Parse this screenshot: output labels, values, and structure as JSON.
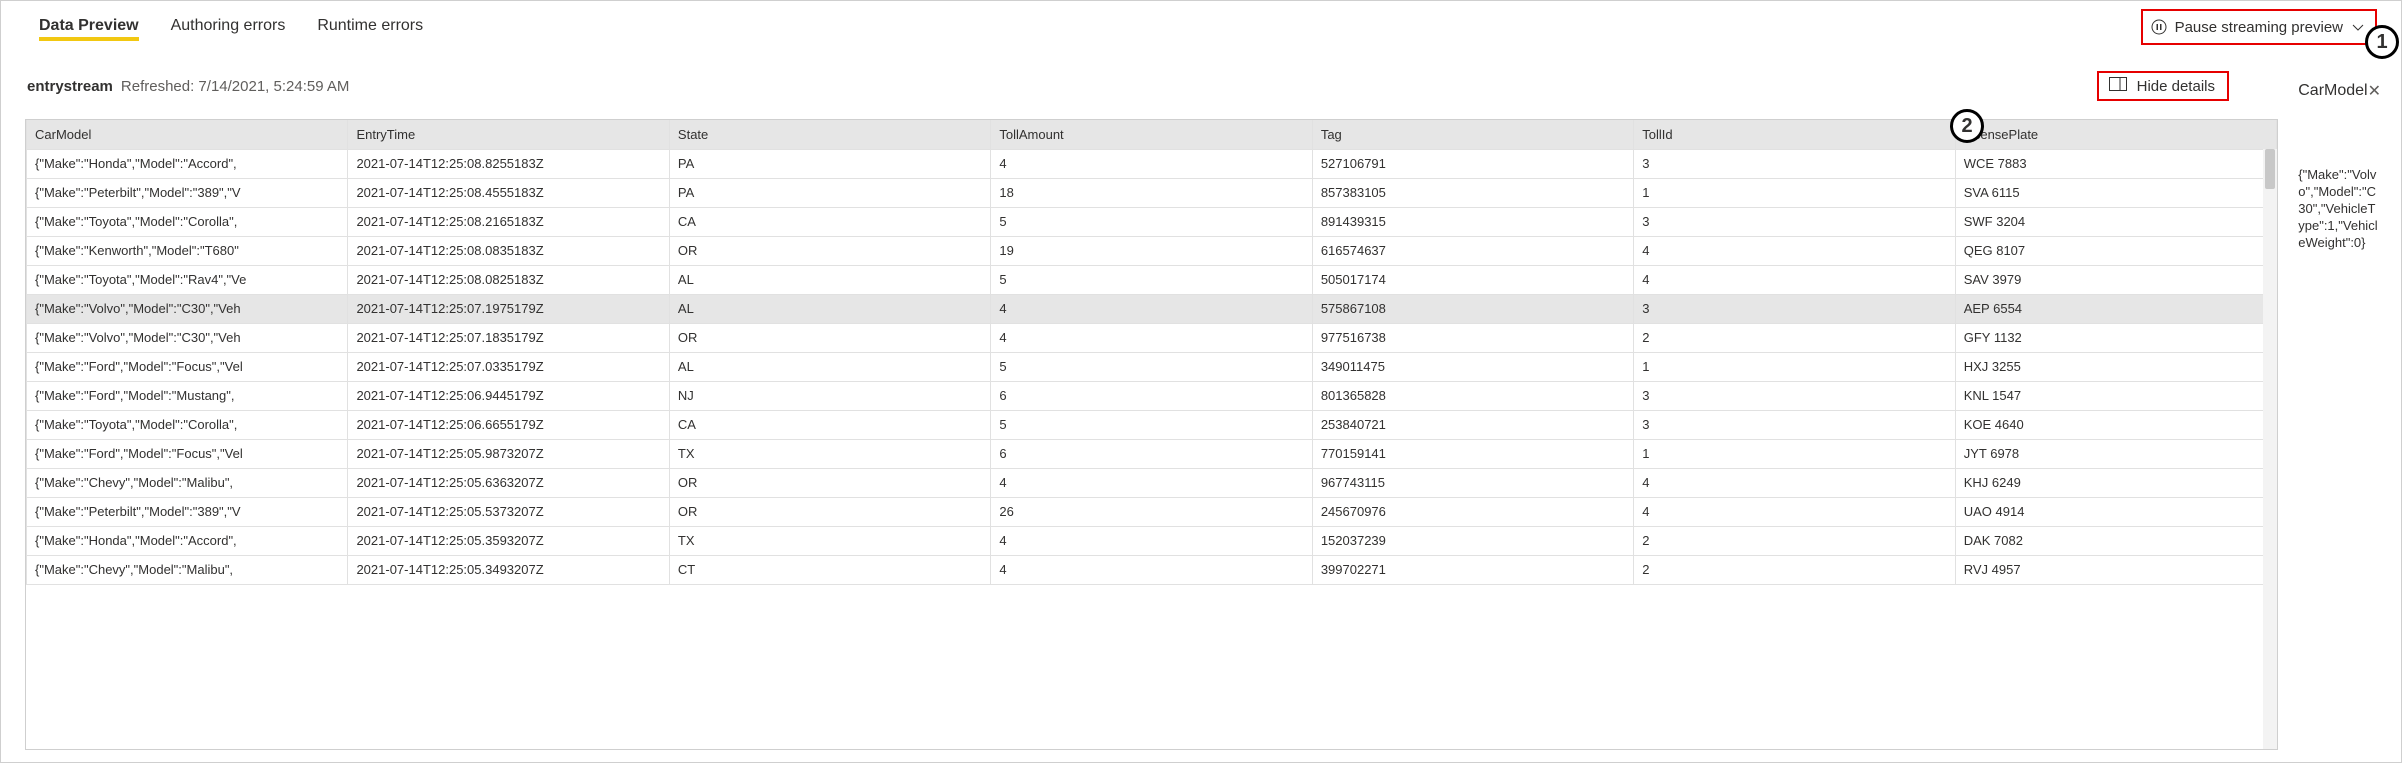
{
  "tabs": {
    "data_preview": "Data Preview",
    "authoring_errors": "Authoring errors",
    "runtime_errors": "Runtime errors"
  },
  "pause_button": "Pause streaming preview",
  "callouts": {
    "one": "1",
    "two": "2"
  },
  "stream": {
    "name": "entrystream",
    "refreshed_label": "Refreshed: 7/14/2021, 5:24:59 AM"
  },
  "hide_details": "Hide details",
  "columns": [
    "CarModel",
    "EntryTime",
    "State",
    "TollAmount",
    "Tag",
    "TollId",
    "LicensePlate"
  ],
  "rows": [
    {
      "CarModel": "{\"Make\":\"Honda\",\"Model\":\"Accord\",",
      "EntryTime": "2021-07-14T12:25:08.8255183Z",
      "State": "PA",
      "TollAmount": "4",
      "Tag": "527106791",
      "TollId": "3",
      "LicensePlate": "WCE 7883"
    },
    {
      "CarModel": "{\"Make\":\"Peterbilt\",\"Model\":\"389\",\"V",
      "EntryTime": "2021-07-14T12:25:08.4555183Z",
      "State": "PA",
      "TollAmount": "18",
      "Tag": "857383105",
      "TollId": "1",
      "LicensePlate": "SVA 6115"
    },
    {
      "CarModel": "{\"Make\":\"Toyota\",\"Model\":\"Corolla\",",
      "EntryTime": "2021-07-14T12:25:08.2165183Z",
      "State": "CA",
      "TollAmount": "5",
      "Tag": "891439315",
      "TollId": "3",
      "LicensePlate": "SWF 3204"
    },
    {
      "CarModel": "{\"Make\":\"Kenworth\",\"Model\":\"T680\"",
      "EntryTime": "2021-07-14T12:25:08.0835183Z",
      "State": "OR",
      "TollAmount": "19",
      "Tag": "616574637",
      "TollId": "4",
      "LicensePlate": "QEG 8107"
    },
    {
      "CarModel": "{\"Make\":\"Toyota\",\"Model\":\"Rav4\",\"Ve",
      "EntryTime": "2021-07-14T12:25:08.0825183Z",
      "State": "AL",
      "TollAmount": "5",
      "Tag": "505017174",
      "TollId": "4",
      "LicensePlate": "SAV 3979"
    },
    {
      "CarModel": "{\"Make\":\"Volvo\",\"Model\":\"C30\",\"Veh",
      "EntryTime": "2021-07-14T12:25:07.1975179Z",
      "State": "AL",
      "TollAmount": "4",
      "Tag": "575867108",
      "TollId": "3",
      "LicensePlate": "AEP 6554",
      "selected": true
    },
    {
      "CarModel": "{\"Make\":\"Volvo\",\"Model\":\"C30\",\"Veh",
      "EntryTime": "2021-07-14T12:25:07.1835179Z",
      "State": "OR",
      "TollAmount": "4",
      "Tag": "977516738",
      "TollId": "2",
      "LicensePlate": "GFY 1132"
    },
    {
      "CarModel": "{\"Make\":\"Ford\",\"Model\":\"Focus\",\"Vel",
      "EntryTime": "2021-07-14T12:25:07.0335179Z",
      "State": "AL",
      "TollAmount": "5",
      "Tag": "349011475",
      "TollId": "1",
      "LicensePlate": "HXJ 3255"
    },
    {
      "CarModel": "{\"Make\":\"Ford\",\"Model\":\"Mustang\",",
      "EntryTime": "2021-07-14T12:25:06.9445179Z",
      "State": "NJ",
      "TollAmount": "6",
      "Tag": "801365828",
      "TollId": "3",
      "LicensePlate": "KNL 1547"
    },
    {
      "CarModel": "{\"Make\":\"Toyota\",\"Model\":\"Corolla\",",
      "EntryTime": "2021-07-14T12:25:06.6655179Z",
      "State": "CA",
      "TollAmount": "5",
      "Tag": "253840721",
      "TollId": "3",
      "LicensePlate": "KOE 4640"
    },
    {
      "CarModel": "{\"Make\":\"Ford\",\"Model\":\"Focus\",\"Vel",
      "EntryTime": "2021-07-14T12:25:05.9873207Z",
      "State": "TX",
      "TollAmount": "6",
      "Tag": "770159141",
      "TollId": "1",
      "LicensePlate": "JYT 6978"
    },
    {
      "CarModel": "{\"Make\":\"Chevy\",\"Model\":\"Malibu\",",
      "EntryTime": "2021-07-14T12:25:05.6363207Z",
      "State": "OR",
      "TollAmount": "4",
      "Tag": "967743115",
      "TollId": "4",
      "LicensePlate": "KHJ 6249"
    },
    {
      "CarModel": "{\"Make\":\"Peterbilt\",\"Model\":\"389\",\"V",
      "EntryTime": "2021-07-14T12:25:05.5373207Z",
      "State": "OR",
      "TollAmount": "26",
      "Tag": "245670976",
      "TollId": "4",
      "LicensePlate": "UAO 4914"
    },
    {
      "CarModel": "{\"Make\":\"Honda\",\"Model\":\"Accord\",",
      "EntryTime": "2021-07-14T12:25:05.3593207Z",
      "State": "TX",
      "TollAmount": "4",
      "Tag": "152037239",
      "TollId": "2",
      "LicensePlate": "DAK 7082"
    },
    {
      "CarModel": "{\"Make\":\"Chevy\",\"Model\":\"Malibu\",",
      "EntryTime": "2021-07-14T12:25:05.3493207Z",
      "State": "CT",
      "TollAmount": "4",
      "Tag": "399702271",
      "TollId": "2",
      "LicensePlate": "RVJ 4957"
    }
  ],
  "detail": {
    "title": "CarModel",
    "body": "{\"Make\":\"Volvo\",\"Model\":\"C30\",\"VehicleType\":1,\"VehicleWeight\":0}"
  }
}
